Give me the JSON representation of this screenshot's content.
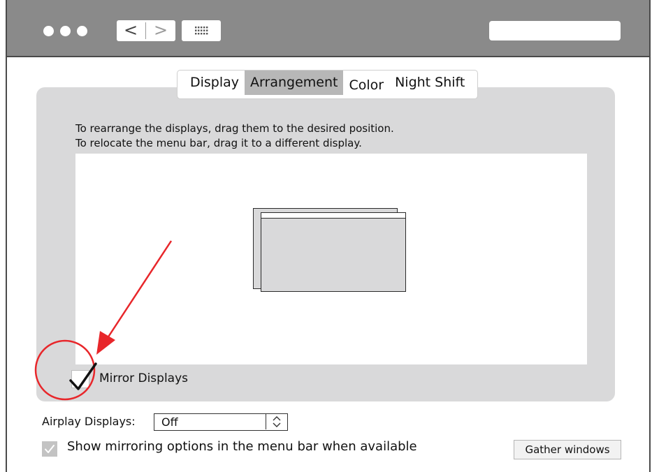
{
  "toolbar": {
    "back_icon": "chevron-left-icon",
    "forward_icon": "chevron-right-icon",
    "back_glyph": "<",
    "forward_glyph": ">",
    "grid_icon": "show-all-grid-icon",
    "search_placeholder": ""
  },
  "tabs": [
    {
      "label": "Display",
      "active": false
    },
    {
      "label": "Arrangement",
      "active": true
    },
    {
      "label": "Color",
      "active": false
    },
    {
      "label": "Night Shift",
      "active": false
    }
  ],
  "instructions": {
    "line1": "To rearrange the displays, drag them to the desired position.",
    "line2": "To relocate the menu bar, drag it to a different display."
  },
  "mirror": {
    "label": "Mirror Displays",
    "checked": true
  },
  "airplay": {
    "label": "Airplay Displays:",
    "value": "Off"
  },
  "show_mirroring": {
    "label": "Show mirroring options in the menu bar when available",
    "checked": true
  },
  "gather_button": {
    "label": "Gather windows"
  },
  "colors": {
    "titlebar": "#8a8a8a",
    "panel": "#d9d9da",
    "active_tab": "#b7b7b7",
    "annotation": "#e8262a"
  }
}
